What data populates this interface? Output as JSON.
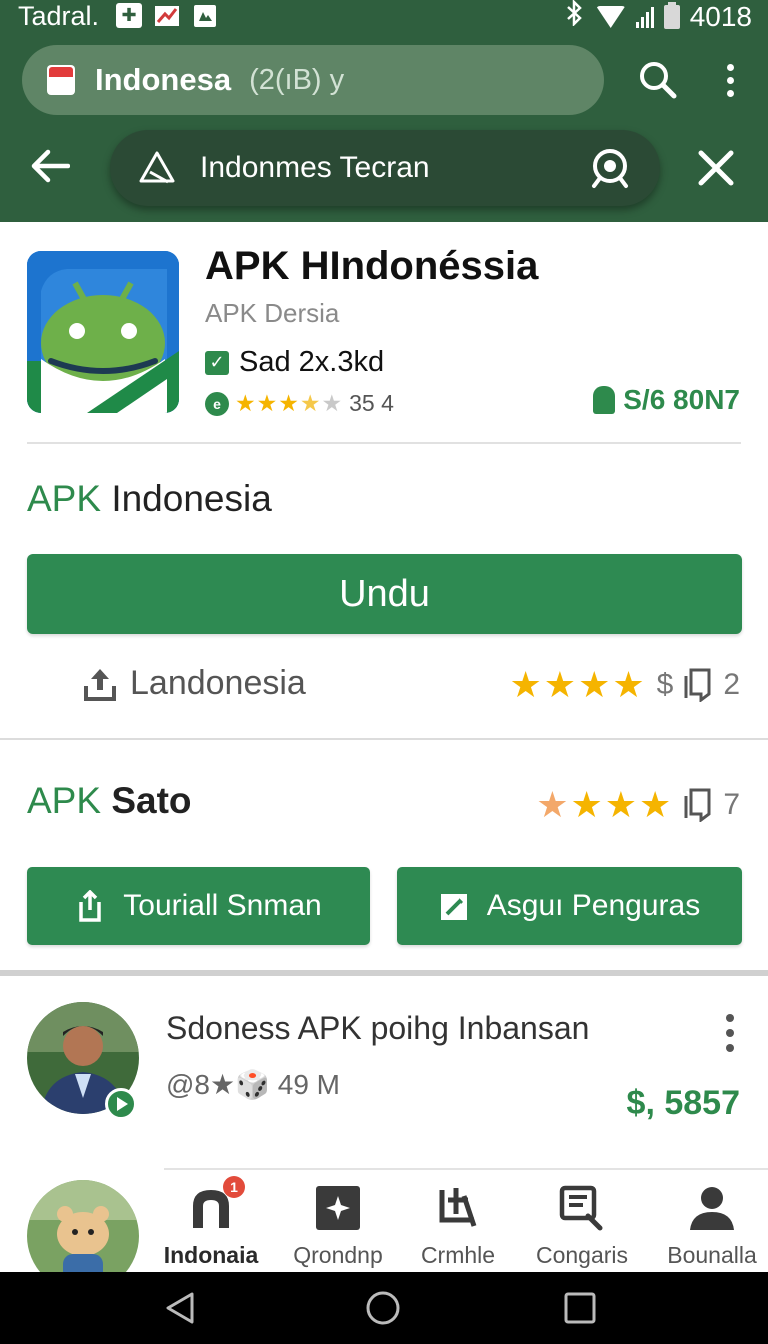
{
  "status_bar": {
    "carrier": "Tadral.",
    "time": "4018",
    "icons": [
      "plus-icon",
      "chart-icon",
      "photo-icon",
      "bluetooth-icon",
      "wifi-icon",
      "signal-icon",
      "battery-icon"
    ],
    "bluetooth_glyph": "Ƀ"
  },
  "browser": {
    "title": "Indonesa",
    "subtitle": "(2(ıB)  y",
    "search_text": "Indonmes Tecran"
  },
  "app": {
    "title": "APK HIndonéssia",
    "developer": "APK Dersia",
    "meta": "Sad 2x.3kd",
    "rating_text": "35 4",
    "size": "S/6 80N7"
  },
  "download_section": {
    "title_green": "APK",
    "title_rest": " Indonesia",
    "button": "Undu",
    "share_label": "Landonesia",
    "rating_symbol": "$",
    "count": "2"
  },
  "sato_section": {
    "title_green": "APK",
    "title_rest": " Sato",
    "count": "7",
    "buttons": [
      {
        "label": "Touriall Snman",
        "icon": "share-icon"
      },
      {
        "label": "Asguı Penguras",
        "icon": "edit-icon"
      }
    ]
  },
  "listing": {
    "title": "Sdoness APK poihg Inbansan",
    "sub": "@8★🎲 49 M",
    "price": "$, 5857"
  },
  "bottom_nav": {
    "items": [
      {
        "label": "Indonaia",
        "icon": "home-icon",
        "badge": "1"
      },
      {
        "label": "Qrondnp",
        "icon": "sparkle-icon"
      },
      {
        "label": "Crmhle",
        "icon": "tools-icon"
      },
      {
        "label": "Congaris",
        "icon": "search-doc-icon"
      },
      {
        "label": "Bounalla",
        "icon": "profile-icon"
      }
    ]
  },
  "colors": {
    "header": "#2f5f3e",
    "accent": "#2e8a52",
    "star": "#f5b400"
  }
}
